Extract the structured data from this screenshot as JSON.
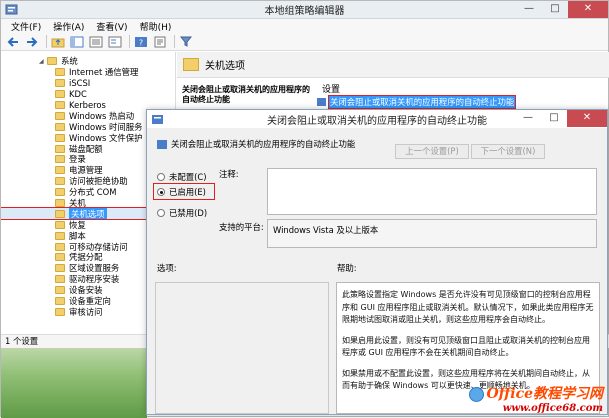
{
  "gpe": {
    "title": "本地组策略编辑器",
    "controls": {
      "min": "—",
      "max": "□",
      "close": "✕"
    },
    "menu": [
      "文件(F)",
      "操作(A)",
      "查看(V)",
      "帮助(H)"
    ],
    "tree": [
      {
        "label": "系统",
        "root": true
      },
      {
        "label": "Internet 通信管理"
      },
      {
        "label": "iSCSI"
      },
      {
        "label": "KDC"
      },
      {
        "label": "Kerberos"
      },
      {
        "label": "Windows 热启动"
      },
      {
        "label": "Windows 时间服务"
      },
      {
        "label": "Windows 文件保护"
      },
      {
        "label": "磁盘配额"
      },
      {
        "label": "登录"
      },
      {
        "label": "电源管理"
      },
      {
        "label": "访问被拒绝协助"
      },
      {
        "label": "分布式 COM"
      },
      {
        "label": "关机"
      },
      {
        "label": "关机选项",
        "selected": true
      },
      {
        "label": "恢复"
      },
      {
        "label": "脚本"
      },
      {
        "label": "可移动存储访问"
      },
      {
        "label": "凭据分配"
      },
      {
        "label": "区域设置服务"
      },
      {
        "label": "驱动程序安装"
      },
      {
        "label": "设备安装"
      },
      {
        "label": "设备重定向"
      },
      {
        "label": "审核访问"
      }
    ],
    "detail": {
      "header": "关机选项",
      "policy_title": "关闭会阻止或取消关机的应用程序的自动终止功能",
      "settings_header": "设置",
      "setting_row": "关闭会阻止或取消关机的应用程序的自动终止功能"
    },
    "status": "1 个设置"
  },
  "dialog": {
    "title": "关闭会阻止或取消关机的应用程序的自动终止功能",
    "subtitle": "关闭会阻止或取消关机的应用程序的自动终止功能",
    "prev_button": "上一个设置(P)",
    "next_button": "下一个设置(N)",
    "radios": {
      "not_configured": "未配置(C)",
      "enabled": "已启用(E)",
      "disabled": "已禁用(D)"
    },
    "comment_label": "注释:",
    "platform_label": "支持的平台:",
    "platform_value": "Windows Vista 及以上版本",
    "options_label": "选项:",
    "help_label": "帮助:",
    "help_paragraphs": [
      "此策略设置指定 Windows 是否允许没有可见顶级窗口的控制台应用程序和 GUI 应用程序阻止或取消关机。默认情况下，如果此类应用程序无限期地试图取消或阻止关机，则这些应用程序会自动终止。",
      "如果启用此设置，则没有可见顶级窗口且阻止或取消关机的控制台应用程序或 GUI 应用程序不会在关机期间自动终止。",
      "如果禁用或不配置此设置，则这些应用程序将在关机期间自动终止，从而有助于确保 Windows 可以更快速、更顺畅地关机。"
    ]
  },
  "watermark": {
    "line1": "Office教程学习网",
    "line2": "www.office68.com"
  },
  "colors": {
    "selection": "#3399ff",
    "highlight_border": "#e02020",
    "close": "#c74b50",
    "folder": "#f1cf6a"
  }
}
